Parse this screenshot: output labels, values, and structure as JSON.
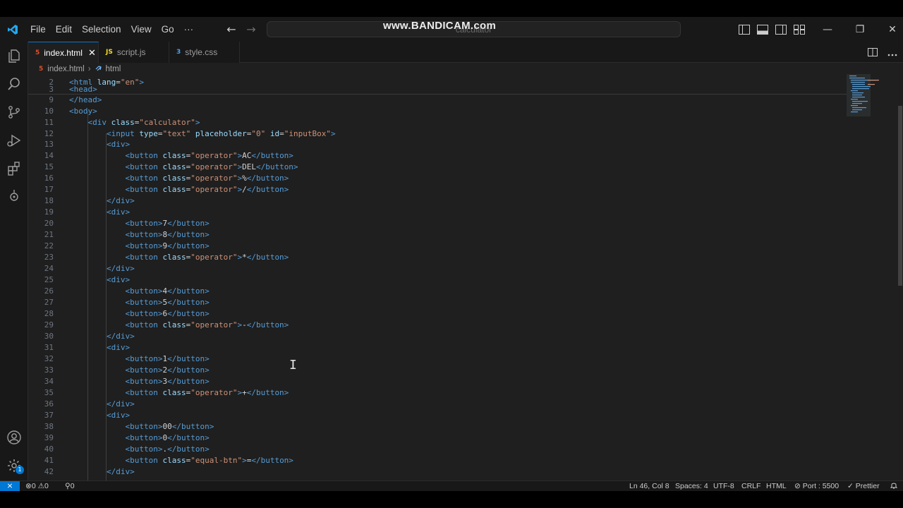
{
  "menu": [
    "File",
    "Edit",
    "Selection",
    "View",
    "Go",
    "···"
  ],
  "nav": {
    "back": "←",
    "forward": "→"
  },
  "command_center": {
    "text": "calculator"
  },
  "watermark": "www.BANDICAM.com",
  "window_controls": {
    "minimize": "—",
    "restore": "❐",
    "close": "✕"
  },
  "tabs": [
    {
      "label": "index.html",
      "icon": "5",
      "type": "html",
      "active": true,
      "close": "✕"
    },
    {
      "label": "script.js",
      "icon": "JS",
      "type": "js",
      "active": false
    },
    {
      "label": "style.css",
      "icon": "3",
      "type": "css",
      "active": false
    }
  ],
  "breadcrumb": {
    "file": "index.html",
    "sep": "›",
    "symbol": "html"
  },
  "code_lines": [
    {
      "n": "2",
      "html": "<span class=\"tag\">&lt;html</span> <span class=\"attr\">lang</span>=<span class=\"str\">\"en\"</span><span class=\"tag\">&gt;</span>"
    },
    {
      "n": "3",
      "html": "<span class=\"tag\">&lt;head&gt;</span>"
    },
    {
      "n": "9",
      "html": "<span class=\"tag\">&lt;/head&gt;</span>"
    },
    {
      "n": "10",
      "html": "<span class=\"tag\">&lt;body&gt;</span>"
    },
    {
      "n": "11",
      "html": "    <span class=\"tag\">&lt;div</span> <span class=\"attr\">class</span>=<span class=\"str\">\"calculator\"</span><span class=\"tag\">&gt;</span>"
    },
    {
      "n": "12",
      "html": "        <span class=\"tag\">&lt;input</span> <span class=\"attr\">type</span>=<span class=\"str\">\"text\"</span> <span class=\"attr\">placeholder</span>=<span class=\"str\">\"0\"</span> <span class=\"attr\">id</span>=<span class=\"str\">\"inputBox\"</span><span class=\"tag\">&gt;</span>"
    },
    {
      "n": "13",
      "html": "        <span class=\"tag\">&lt;div&gt;</span>"
    },
    {
      "n": "14",
      "html": "            <span class=\"tag\">&lt;button</span> <span class=\"attr\">class</span>=<span class=\"str\">\"operator\"</span><span class=\"tag\">&gt;</span><span class=\"txt\">AC</span><span class=\"tag\">&lt;/button&gt;</span>"
    },
    {
      "n": "15",
      "html": "            <span class=\"tag\">&lt;button</span> <span class=\"attr\">class</span>=<span class=\"str\">\"operator\"</span><span class=\"tag\">&gt;</span><span class=\"txt\">DEL</span><span class=\"tag\">&lt;/button&gt;</span>"
    },
    {
      "n": "16",
      "html": "            <span class=\"tag\">&lt;button</span> <span class=\"attr\">class</span>=<span class=\"str\">\"operator\"</span><span class=\"tag\">&gt;</span><span class=\"txt\">%</span><span class=\"tag\">&lt;/button&gt;</span>"
    },
    {
      "n": "17",
      "html": "            <span class=\"tag\">&lt;button</span> <span class=\"attr\">class</span>=<span class=\"str\">\"operator\"</span><span class=\"tag\">&gt;</span><span class=\"txt\">/</span><span class=\"tag\">&lt;/button&gt;</span>"
    },
    {
      "n": "18",
      "html": "        <span class=\"tag\">&lt;/div&gt;</span>"
    },
    {
      "n": "19",
      "html": "        <span class=\"tag\">&lt;div&gt;</span>"
    },
    {
      "n": "20",
      "html": "            <span class=\"tag\">&lt;button&gt;</span><span class=\"txt\">7</span><span class=\"tag\">&lt;/button&gt;</span>"
    },
    {
      "n": "21",
      "html": "            <span class=\"tag\">&lt;button&gt;</span><span class=\"txt\">8</span><span class=\"tag\">&lt;/button&gt;</span>"
    },
    {
      "n": "22",
      "html": "            <span class=\"tag\">&lt;button&gt;</span><span class=\"txt\">9</span><span class=\"tag\">&lt;/button&gt;</span>"
    },
    {
      "n": "23",
      "html": "            <span class=\"tag\">&lt;button</span> <span class=\"attr\">class</span>=<span class=\"str\">\"operator\"</span><span class=\"tag\">&gt;</span><span class=\"txt\">*</span><span class=\"tag\">&lt;/button&gt;</span>"
    },
    {
      "n": "24",
      "html": "        <span class=\"tag\">&lt;/div&gt;</span>"
    },
    {
      "n": "25",
      "html": "        <span class=\"tag\">&lt;div&gt;</span>"
    },
    {
      "n": "26",
      "html": "            <span class=\"tag\">&lt;button&gt;</span><span class=\"txt\">4</span><span class=\"tag\">&lt;/button&gt;</span>"
    },
    {
      "n": "27",
      "html": "            <span class=\"tag\">&lt;button&gt;</span><span class=\"txt\">5</span><span class=\"tag\">&lt;/button&gt;</span>"
    },
    {
      "n": "28",
      "html": "            <span class=\"tag\">&lt;button&gt;</span><span class=\"txt\">6</span><span class=\"tag\">&lt;/button&gt;</span>"
    },
    {
      "n": "29",
      "html": "            <span class=\"tag\">&lt;button</span> <span class=\"attr\">class</span>=<span class=\"str\">\"operator\"</span><span class=\"tag\">&gt;</span><span class=\"txt\">-</span><span class=\"tag\">&lt;/button&gt;</span>"
    },
    {
      "n": "30",
      "html": "        <span class=\"tag\">&lt;/div&gt;</span>"
    },
    {
      "n": "31",
      "html": "        <span class=\"tag\">&lt;div&gt;</span>"
    },
    {
      "n": "32",
      "html": "            <span class=\"tag\">&lt;button&gt;</span><span class=\"txt\">1</span><span class=\"tag\">&lt;/button&gt;</span>"
    },
    {
      "n": "33",
      "html": "            <span class=\"tag\">&lt;button&gt;</span><span class=\"txt\">2</span><span class=\"tag\">&lt;/button&gt;</span>"
    },
    {
      "n": "34",
      "html": "            <span class=\"tag\">&lt;button&gt;</span><span class=\"txt\">3</span><span class=\"tag\">&lt;/button&gt;</span>"
    },
    {
      "n": "35",
      "html": "            <span class=\"tag\">&lt;button</span> <span class=\"attr\">class</span>=<span class=\"str\">\"operator\"</span><span class=\"tag\">&gt;</span><span class=\"txt\">+</span><span class=\"tag\">&lt;/button&gt;</span>"
    },
    {
      "n": "36",
      "html": "        <span class=\"tag\">&lt;/div&gt;</span>"
    },
    {
      "n": "37",
      "html": "        <span class=\"tag\">&lt;div&gt;</span>"
    },
    {
      "n": "38",
      "html": "            <span class=\"tag\">&lt;button&gt;</span><span class=\"txt\">00</span><span class=\"tag\">&lt;/button&gt;</span>"
    },
    {
      "n": "39",
      "html": "            <span class=\"tag\">&lt;button&gt;</span><span class=\"txt\">0</span><span class=\"tag\">&lt;/button&gt;</span>"
    },
    {
      "n": "40",
      "html": "            <span class=\"tag\">&lt;button&gt;</span><span class=\"txt\">.</span><span class=\"tag\">&lt;/button&gt;</span>"
    },
    {
      "n": "41",
      "html": "            <span class=\"tag\">&lt;button</span> <span class=\"attr\">class</span>=<span class=\"str\">\"equal-btn\"</span><span class=\"tag\">&gt;</span><span class=\"txt\">=</span><span class=\"tag\">&lt;/button&gt;</span>"
    },
    {
      "n": "42",
      "html": "        <span class=\"tag\">&lt;/div&gt;</span>"
    }
  ],
  "status": {
    "errors": "0",
    "warnings": "0",
    "ports": "0",
    "position": "Ln 46, Col 8",
    "spaces": "Spaces: 4",
    "encoding": "UTF-8",
    "eol": "CRLF",
    "language": "HTML",
    "live_server": "Port : 5500",
    "prettier": "Prettier"
  },
  "badges": {
    "accounts": "1"
  },
  "colors": {
    "accent": "#0078d4",
    "tag": "#569cd6",
    "attribute": "#9cdcfe",
    "string": "#ce9178"
  }
}
